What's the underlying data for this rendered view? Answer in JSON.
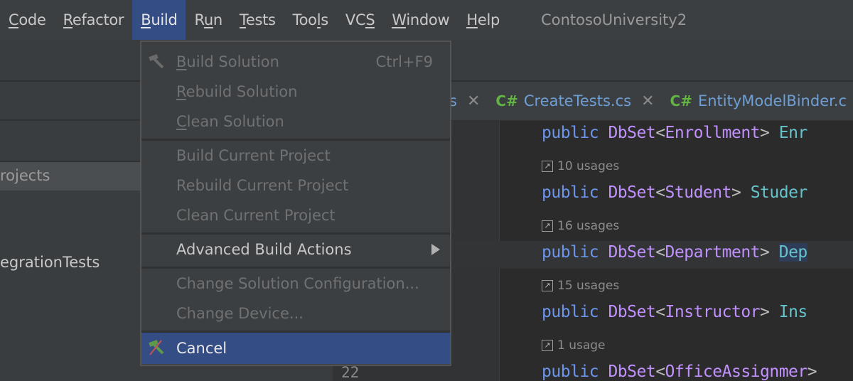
{
  "menubar": {
    "items": [
      {
        "label": "Code",
        "mnemonic": 0
      },
      {
        "label": "Refactor",
        "mnemonic": 0
      },
      {
        "label": "Build",
        "mnemonic": 0,
        "active": true
      },
      {
        "label": "Run",
        "mnemonic": 1
      },
      {
        "label": "Tests",
        "mnemonic": 0
      },
      {
        "label": "Tools",
        "mnemonic": 3
      },
      {
        "label": "VCS",
        "mnemonic": 2
      },
      {
        "label": "Window",
        "mnemonic": 0
      },
      {
        "label": "Help",
        "mnemonic": 0
      }
    ],
    "title": "ContosoUniversity2"
  },
  "left_panel": {
    "selected_row": "rojects",
    "item": "egrationTests"
  },
  "tabs": [
    {
      "label": "s",
      "partial": true
    },
    {
      "label": "CreateTests.cs",
      "lang": "C#"
    },
    {
      "label": "EntityModelBinder.c",
      "lang": "C#"
    }
  ],
  "gutter": {
    "line_number": "22"
  },
  "code": {
    "lines": [
      {
        "kw": "public",
        "type": "DbSet",
        "generic": "Enrollment",
        "name": "Enr"
      },
      {
        "kw": "public",
        "type": "DbSet",
        "generic": "Student",
        "name": "Studer"
      },
      {
        "kw": "public",
        "type": "DbSet",
        "generic": "Department",
        "name": "Dep"
      },
      {
        "kw": "public",
        "type": "DbSet",
        "generic": "Instructor",
        "name": "Ins"
      },
      {
        "kw": "public",
        "type": "DbSet",
        "generic": "OfficeAssignmer",
        "name": ""
      }
    ],
    "usages": [
      "10 usages",
      "16 usages",
      "15 usages",
      "1 usage"
    ]
  },
  "build_menu": {
    "items": [
      {
        "label": "Build Solution",
        "mnemonic": 0,
        "shortcut": "Ctrl+F9",
        "enabled": false,
        "icon": "hammer-icon"
      },
      {
        "label": "Rebuild Solution",
        "mnemonic": 0,
        "enabled": false
      },
      {
        "label": "Clean Solution",
        "mnemonic": 0,
        "enabled": false
      },
      {
        "separator": true
      },
      {
        "label": "Build Current Project",
        "enabled": false
      },
      {
        "label": "Rebuild Current Project",
        "enabled": false
      },
      {
        "label": "Clean Current Project",
        "enabled": false
      },
      {
        "separator": true
      },
      {
        "label": "Advanced Build Actions",
        "enabled": true,
        "submenu": true
      },
      {
        "separator": true
      },
      {
        "label": "Change Solution Configuration...",
        "enabled": false
      },
      {
        "label": "Change Device...",
        "enabled": false
      },
      {
        "separator": true
      },
      {
        "label": "Cancel",
        "enabled": true,
        "selected": true,
        "icon": "cancel-build-icon"
      }
    ]
  },
  "colors": {
    "accent": "#344d84",
    "keyword": "#6c95eb",
    "type": "#c191ff",
    "identifier": "#66c3cc",
    "csharp": "#62b543"
  }
}
